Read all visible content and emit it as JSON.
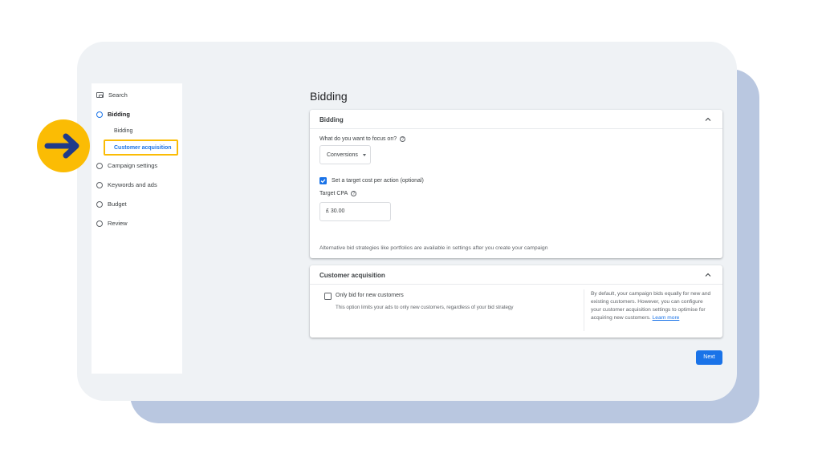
{
  "colors": {
    "accent": "#1a73e8",
    "highlight": "#fbbc04",
    "card_back": "#b9c7e0",
    "card_front": "#eff2f5"
  },
  "annotation": {
    "icon": "arrow-right-icon"
  },
  "sidebar": {
    "search_label": "Search",
    "items": [
      {
        "label": "Bidding",
        "icon": "radio-circle-icon",
        "active": true
      },
      {
        "label": "Campaign settings",
        "icon": "radio-circle-icon"
      },
      {
        "label": "Keywords and ads",
        "icon": "radio-circle-icon"
      },
      {
        "label": "Budget",
        "icon": "radio-circle-icon"
      },
      {
        "label": "Review",
        "icon": "radio-circle-icon"
      }
    ],
    "sub_items": [
      {
        "label": "Bidding"
      },
      {
        "label": "Customer acquisition",
        "active": true
      }
    ]
  },
  "main": {
    "title": "Bidding",
    "bidding_panel": {
      "title": "Bidding",
      "focus_label": "What do you want to focus on?",
      "focus_value": "Conversions",
      "target_checkbox_label": "Set a target cost per action (optional)",
      "target_checked": true,
      "target_cpa_label": "Target CPA",
      "target_cpa_value": "£ 30.00",
      "footnote": "Alternative bid strategies like portfolios are available in settings after you create your campaign"
    },
    "customer_panel": {
      "title": "Customer acquisition",
      "checkbox_label": "Only bid for new customers",
      "checked": false,
      "hint": "This option limits your ads to only new customers, regardless of your bid strategy",
      "side_note": "By default, your campaign bids equally for new and existing customers. However, you can configure your customer acquisition settings to optimise for acquiring new customers.",
      "learn_more": "Learn more"
    },
    "next_label": "Next"
  }
}
